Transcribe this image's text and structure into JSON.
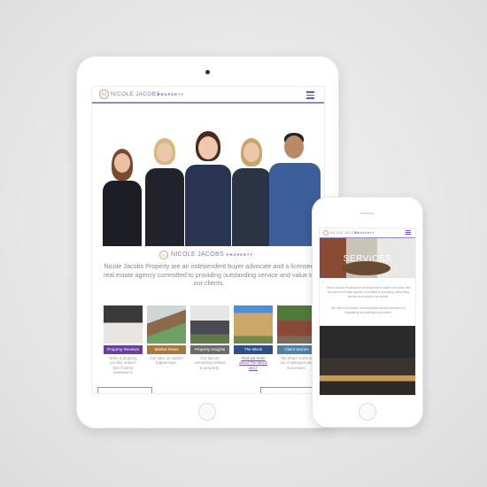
{
  "tablet": {
    "header": {
      "brand_name": "NICOLE JACOBS",
      "brand_suffix": "PROPERTY",
      "logo_monogram": "NJ"
    },
    "logo_bar": {
      "brand_name": "NICOLE JACOBS",
      "brand_suffix": "PROPERTY"
    },
    "intro": "Nicole Jacobs Property are an independent buyer advocate and a licensed real estate agency committed to providing outstanding service and value to our clients.",
    "tiles": [
      {
        "label": "Property Reviews",
        "caption": "Seen a property you like online? See if we've reviewed it.",
        "color": "#6a3fa0"
      },
      {
        "label": "Market News",
        "caption": "Our take on market happenings.",
        "color": "#a8793f"
      },
      {
        "label": "Property Insights",
        "caption": "Our tips on everything related to property.",
        "color": "#6b6b6b"
      },
      {
        "label": "The Block",
        "caption": "Find out more about The Block 2017",
        "color": "#2f4f86"
      },
      {
        "label": "Client Stories",
        "caption": "We share some of our challenges and successes.",
        "color": "#4f7fa6"
      }
    ]
  },
  "phone": {
    "header": {
      "brand_name": "NICOLE JACOBS",
      "brand_suffix": "PROPERTY"
    },
    "hero_title": "SERVICES",
    "paragraphs": [
      "Nicole Jacobs Property are an independent buyers advocate and licensed real estate agency committed to providing outstanding service and value to our clients.",
      "We offer a full search and acquisition service through to a negotiating and bidding only service."
    ]
  },
  "colors": {
    "accent": "#7a4fb5",
    "gold": "#c9a77a"
  }
}
